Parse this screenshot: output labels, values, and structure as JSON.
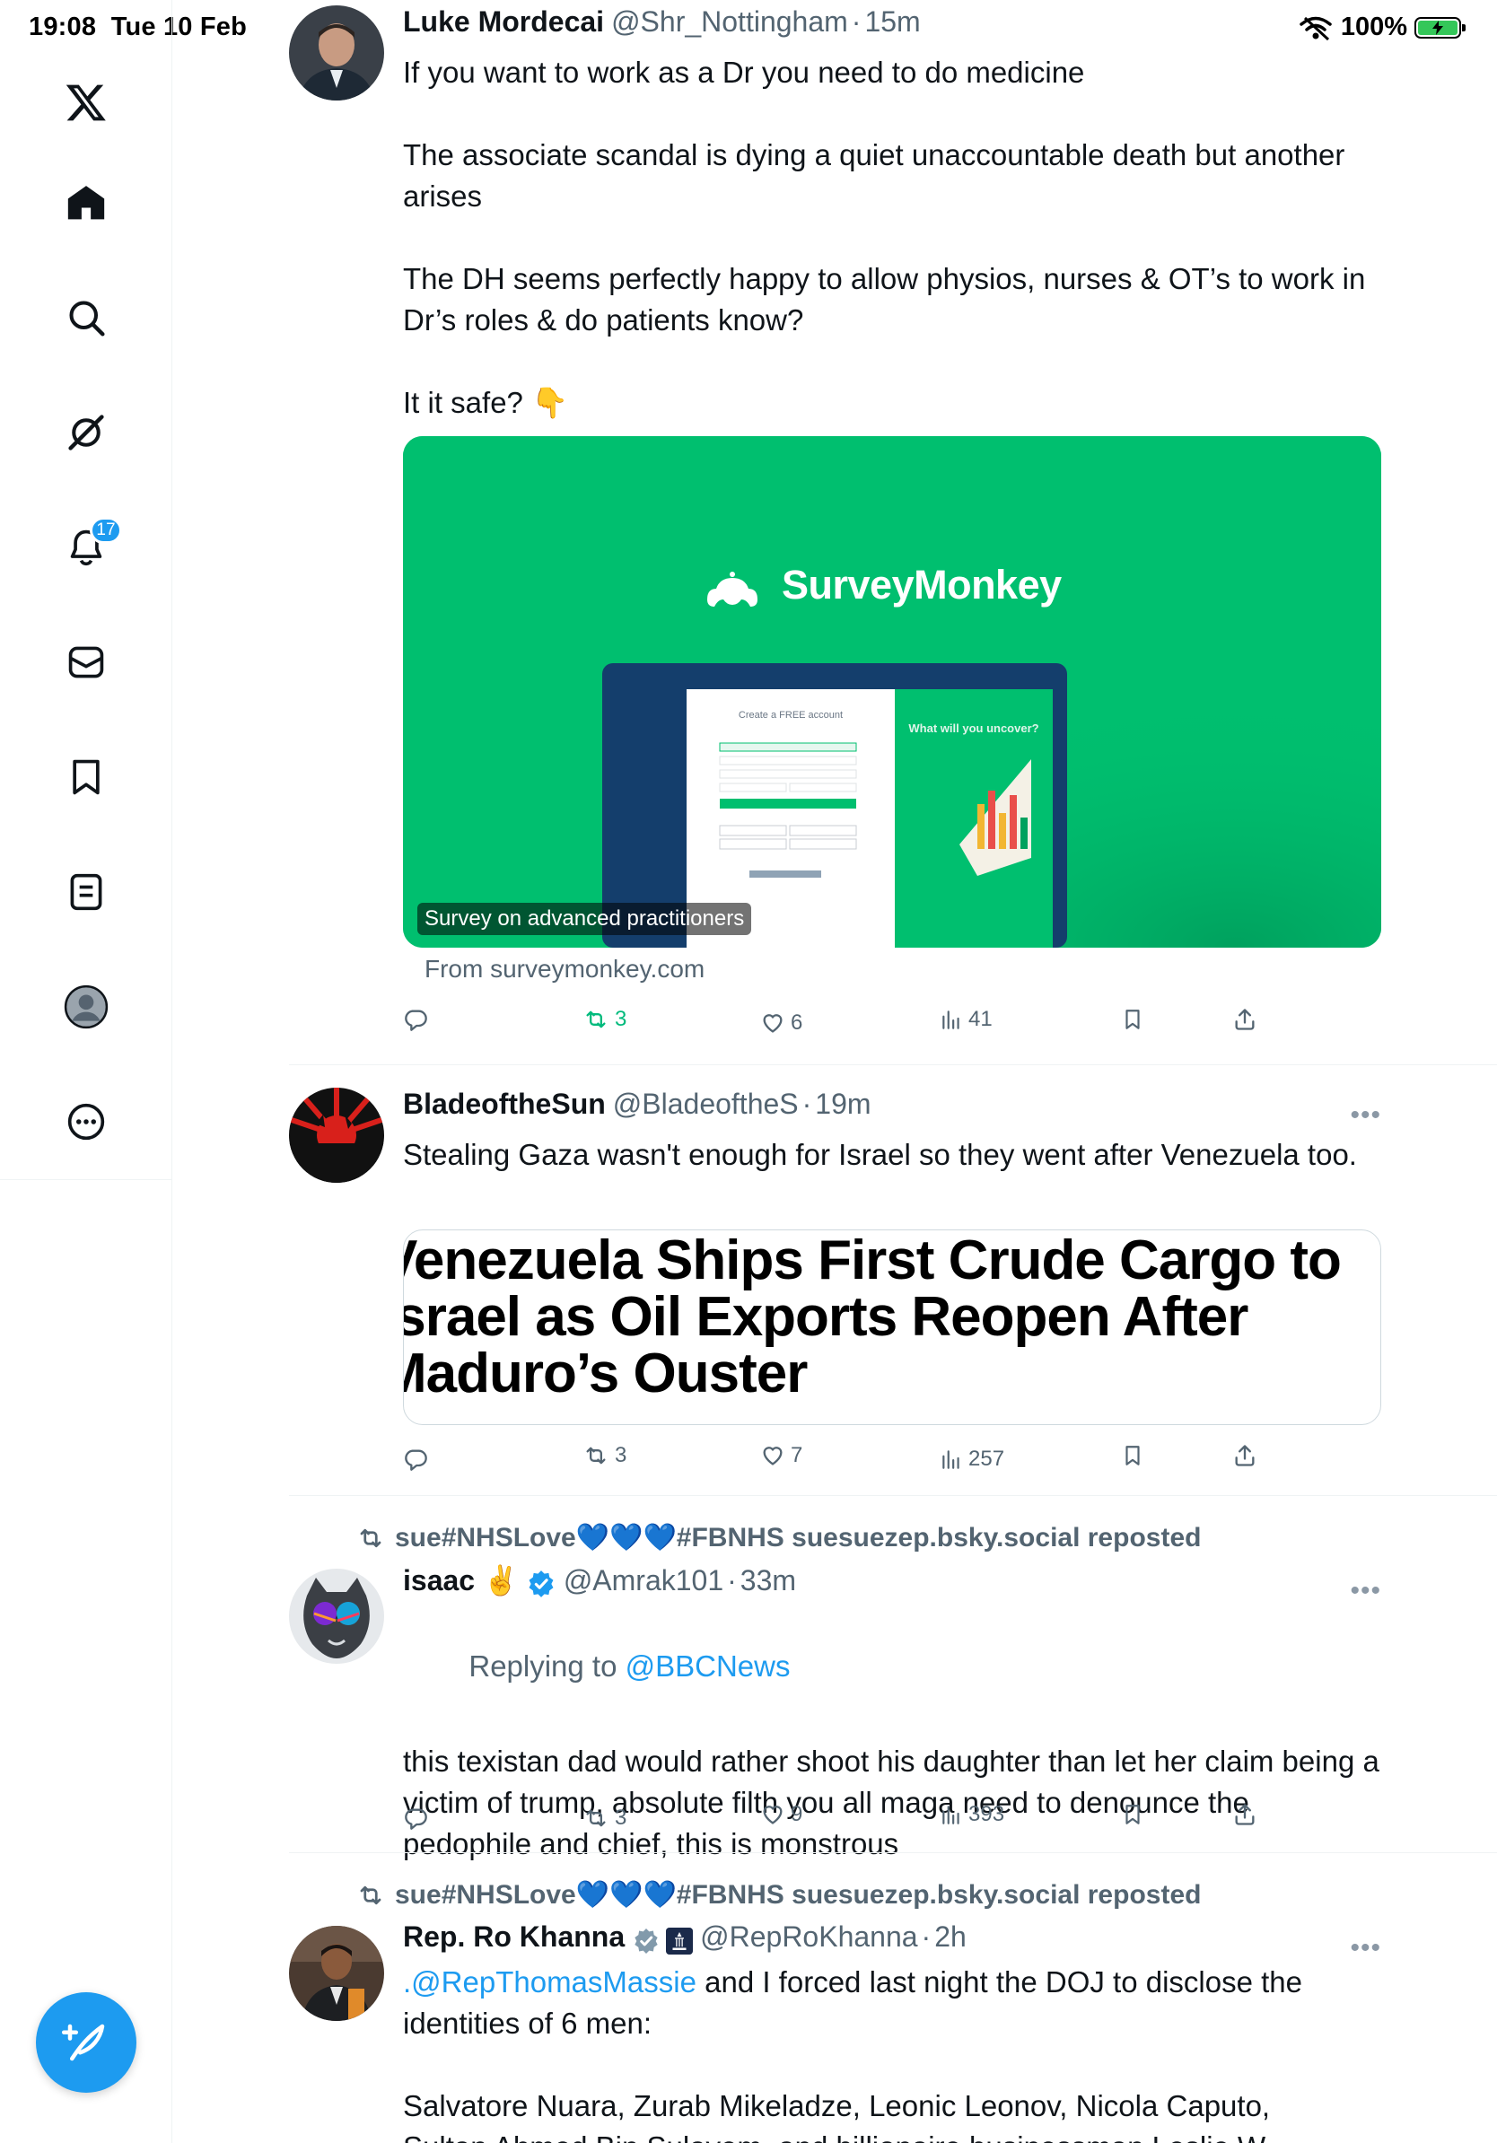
{
  "status_bar": {
    "time": "19:08",
    "date": "Tue 10 Feb",
    "battery": "100%"
  },
  "sidebar": {
    "items": [
      {
        "name": "x-logo",
        "icon": "x-logo-icon"
      },
      {
        "name": "home",
        "icon": "home-icon"
      },
      {
        "name": "explore",
        "icon": "search-icon"
      },
      {
        "name": "grok",
        "icon": "grok-icon"
      },
      {
        "name": "notifications",
        "icon": "bell-icon",
        "badge": "17"
      },
      {
        "name": "messages",
        "icon": "mail-icon"
      },
      {
        "name": "bookmarks",
        "icon": "bookmark-icon"
      },
      {
        "name": "lists",
        "icon": "list-icon"
      },
      {
        "name": "profile",
        "icon": "profile-icon"
      },
      {
        "name": "more",
        "icon": "more-circle-icon"
      }
    ],
    "compose_icon": "compose-feather-icon"
  },
  "tweets": [
    {
      "name": "Luke Mordecai",
      "handle": "@Shr_Nottingham",
      "time": "15m",
      "text": "If you want to work as a Dr you need to do medicine\n\nThe associate scandal is dying a quiet unaccountable death but another arises\n\nThe DH seems perfectly happy to allow physios, nurses & OT’s to work in Dr’s roles & do patients know?\n\nIt it safe? 👇",
      "card": {
        "brand": "SurveyMonkey",
        "label": "Survey on advanced practitioners",
        "from": "From surveymonkey.com",
        "form_title": "Create a FREE account",
        "tagline": "What will you uncover?"
      },
      "stats": {
        "replies": "",
        "reposts": "3",
        "likes": "6",
        "views": "41"
      }
    },
    {
      "name": "BladeoftheSun",
      "handle": "@BladeoftheS",
      "time": "19m",
      "text": "Stealing Gaza wasn't enough for Israel so they went after Venezuela too.",
      "article_title": "Venezuela Ships First Crude Cargo to Israel as Oil Exports Reopen After Maduro’s Ouster",
      "stats": {
        "replies": "",
        "reposts": "3",
        "likes": "7",
        "views": "257"
      }
    },
    {
      "repost_by": "sue#NHSLove💙💙💙#FBNHS suesuezep.bsky.social reposted",
      "name": "isaac ✌️",
      "handle": "@Amrak101",
      "time": "33m",
      "replying_prefix": "Replying to ",
      "replying_to": "@BBCNews",
      "text": "this texistan dad would rather shoot his daughter than let her claim being a victim of trump, absolute filth you all maga need to denounce the pedophile and chief, this is monstrous",
      "stats": {
        "replies": "",
        "reposts": "3",
        "likes": "9",
        "views": "393"
      }
    },
    {
      "repost_by": "sue#NHSLove💙💙💙#FBNHS suesuezep.bsky.social reposted",
      "name": "Rep. Ro Khanna",
      "handle": "@RepRoKhanna",
      "time": "2h",
      "mention": ".@RepThomasMassie",
      "text_after_mention": " and I forced last night the DOJ to disclose the identities of 6 men:",
      "text2": "Salvatore Nuara, Zurab Mikeladze, Leonic Leonov, Nicola Caputo,",
      "text3": "Sultan Ahmed Bin Sulayem, and billionaire businessman Leslie W"
    }
  ],
  "colors": {
    "accent": "#1d9bf0",
    "repost_green": "#00ba7c",
    "survey_green": "#00bf6f",
    "muted": "#536471"
  }
}
